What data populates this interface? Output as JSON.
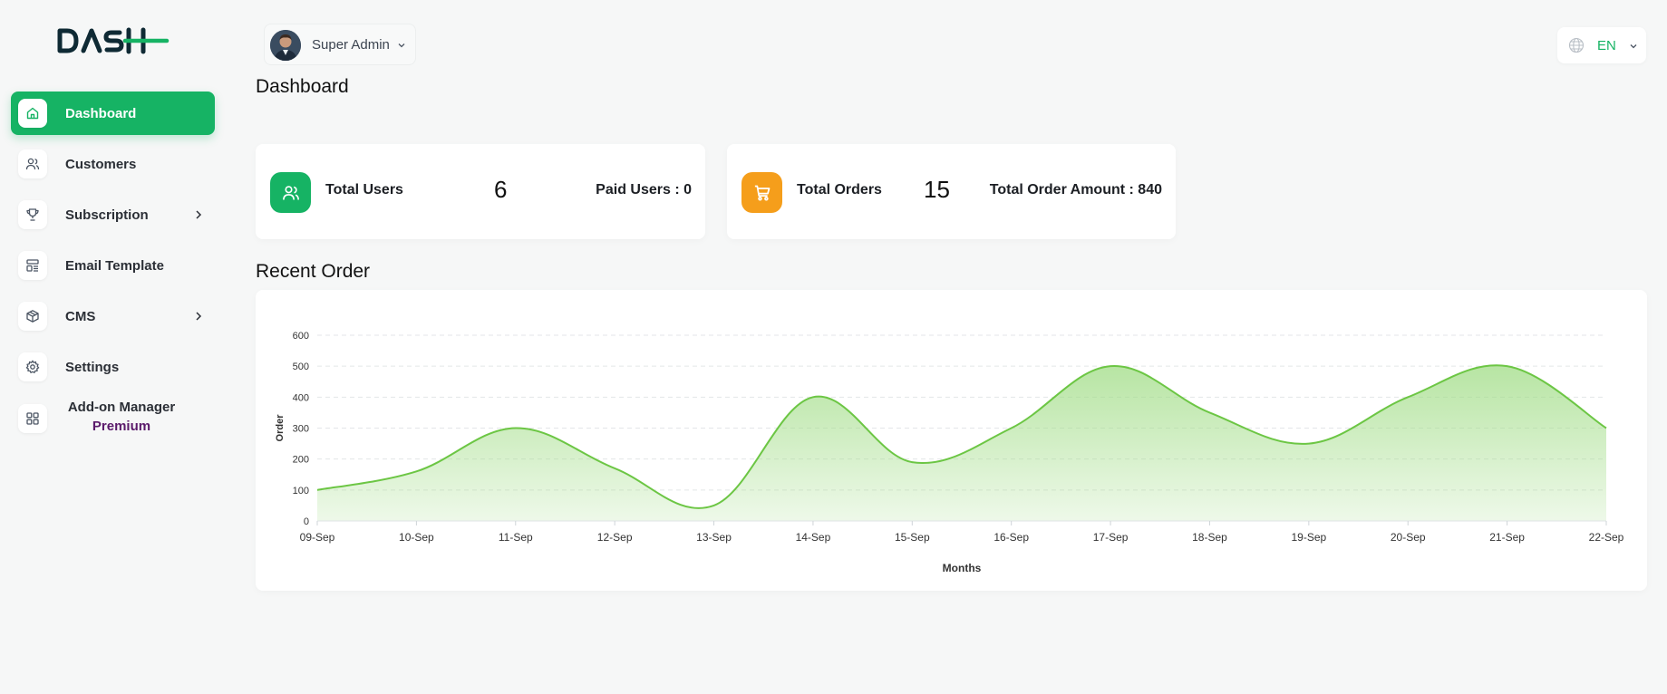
{
  "brand": {
    "logo_text": "DASH",
    "accent": "#16b364"
  },
  "sidebar": {
    "items": [
      {
        "label": "Dashboard",
        "icon": "home-icon",
        "active": true,
        "has_chevron": false
      },
      {
        "label": "Customers",
        "icon": "users-icon",
        "active": false,
        "has_chevron": false
      },
      {
        "label": "Subscription",
        "icon": "trophy-icon",
        "active": false,
        "has_chevron": true
      },
      {
        "label": "Email Template",
        "icon": "template-icon",
        "active": false,
        "has_chevron": false
      },
      {
        "label": "CMS",
        "icon": "cube-icon",
        "active": false,
        "has_chevron": true
      },
      {
        "label": "Settings",
        "icon": "gear-icon",
        "active": false,
        "has_chevron": false
      }
    ],
    "addon": {
      "label": "Add-on Manager",
      "badge": "Premium",
      "icon": "grid-icon"
    }
  },
  "header": {
    "user_name": "Super Admin",
    "language": "EN"
  },
  "page": {
    "title": "Dashboard"
  },
  "stats": {
    "users": {
      "label": "Total Users",
      "value": "6",
      "sub": "Paid Users : 0",
      "color": "#16b364"
    },
    "orders": {
      "label": "Total Orders",
      "value": "15",
      "sub": "Total Order Amount : 840",
      "color": "#f59e1b"
    }
  },
  "recent_order": {
    "title": "Recent Order"
  },
  "chart_data": {
    "type": "area",
    "x": [
      "09-Sep",
      "10-Sep",
      "11-Sep",
      "12-Sep",
      "13-Sep",
      "14-Sep",
      "15-Sep",
      "16-Sep",
      "17-Sep",
      "18-Sep",
      "19-Sep",
      "20-Sep",
      "21-Sep",
      "22-Sep"
    ],
    "series": [
      {
        "values": [
          100,
          160,
          300,
          170,
          50,
          400,
          190,
          300,
          500,
          350,
          250,
          400,
          500,
          300
        ]
      }
    ],
    "xlabel": "Months",
    "ylabel": "Order",
    "ylim": [
      0,
      600
    ],
    "yticks": [
      0,
      100,
      200,
      300,
      400,
      500,
      600
    ],
    "grid": true,
    "line_color": "#6cc644",
    "fill_color": "#9fdc84"
  }
}
